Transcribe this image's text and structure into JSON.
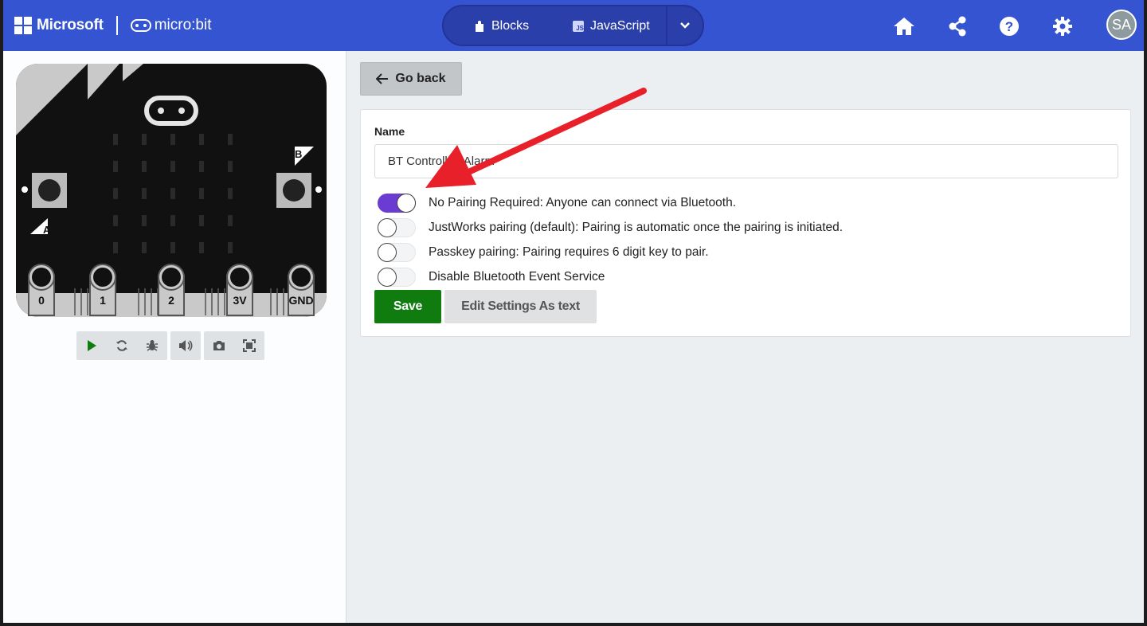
{
  "header": {
    "microsoft_label": "Microsoft",
    "microbit_label": "micro:bit",
    "tabs": [
      {
        "label": "Blocks",
        "icon": "puzzle-icon"
      },
      {
        "label": "JavaScript",
        "icon": "js-icon"
      }
    ],
    "js_icon_text": "JS",
    "avatar_initials": "SA",
    "icons": [
      "home-icon",
      "share-icon",
      "help-icon",
      "settings-icon"
    ],
    "color": "#3454d1"
  },
  "simulator": {
    "pins": [
      "0",
      "1",
      "2",
      "3V",
      "GND"
    ],
    "button_a": "A",
    "button_b": "B",
    "tools": [
      "play-icon",
      "restart-icon",
      "debug-icon",
      "sound-icon",
      "screenshot-icon",
      "fullscreen-icon"
    ]
  },
  "settings": {
    "go_back_label": "Go back",
    "name_label": "Name",
    "name_value": "BT Controlled Alarm",
    "options": [
      {
        "label": "No Pairing Required: Anyone can connect via Bluetooth.",
        "on": true
      },
      {
        "label": "JustWorks pairing (default): Pairing is automatic once the pairing is initiated.",
        "on": false
      },
      {
        "label": "Passkey pairing: Pairing requires 6 digit key to pair.",
        "on": false
      },
      {
        "label": "Disable Bluetooth Event Service",
        "on": false
      }
    ],
    "save_label": "Save",
    "edit_text_label": "Edit Settings As text",
    "accent_color": "#6b3cd1",
    "save_color": "#107c10"
  },
  "annotation": {
    "color": "#e8202a",
    "icon": "red-arrow"
  }
}
